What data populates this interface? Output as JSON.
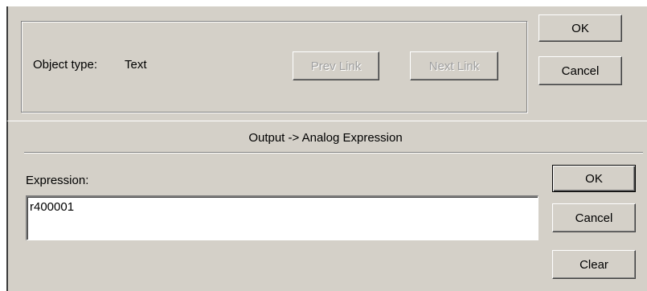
{
  "top": {
    "object_type_label": "Object type:",
    "object_type_value": "Text",
    "prev_link_label": "Prev Link",
    "next_link_label": "Next Link",
    "ok_label": "OK",
    "cancel_label": "Cancel"
  },
  "bottom": {
    "title": "Output -> Analog Expression",
    "expression_label": "Expression:",
    "expression_value": "r400001",
    "ok_label": "OK",
    "cancel_label": "Cancel",
    "clear_label": "Clear"
  }
}
